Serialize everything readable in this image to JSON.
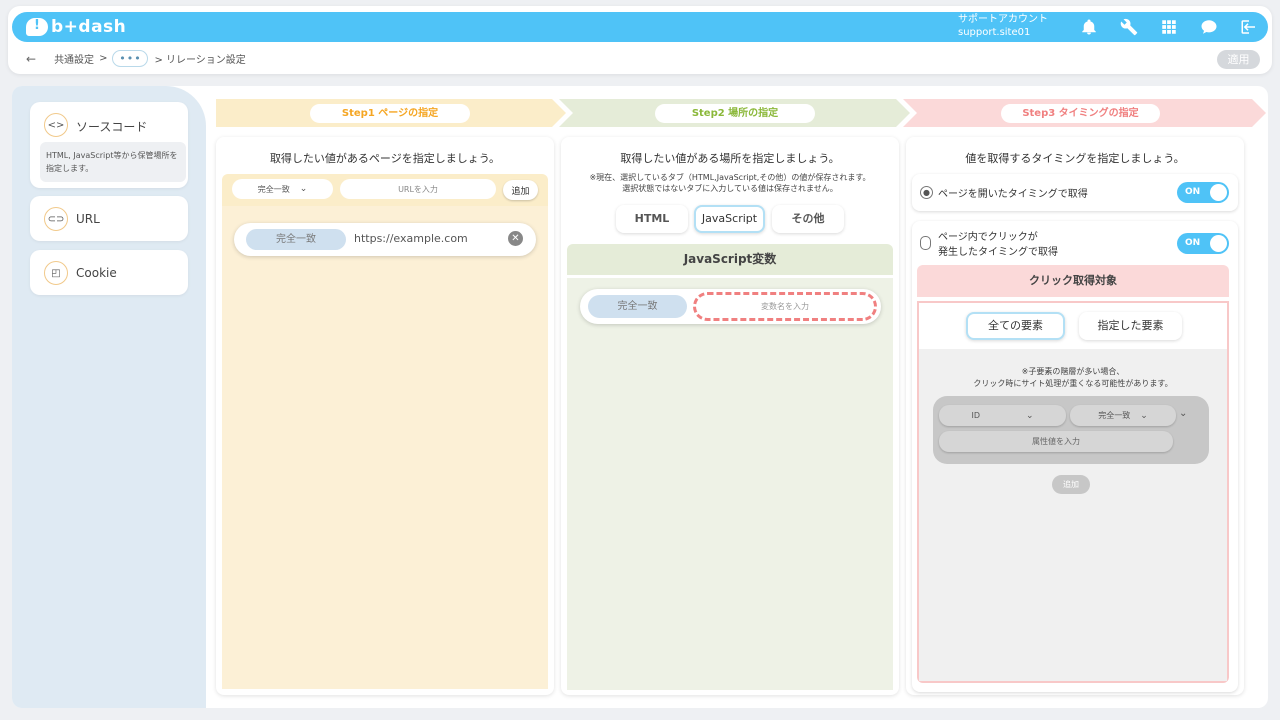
{
  "app": {
    "logo": "b+dash"
  },
  "header": {
    "account_title": "サポートアカウント",
    "account_id": "support.site01",
    "icons": [
      "bell-icon",
      "wrench-icon",
      "grid-icon",
      "chat-icon",
      "logout-icon"
    ]
  },
  "breadcrumb": {
    "back": "←",
    "first": "共通設定",
    "sep": ">",
    "dots": "•••",
    "current": "> リレーション設定"
  },
  "apply_label": "適用",
  "sidebar": {
    "items": [
      {
        "icon": "code-icon",
        "glyph": "<>",
        "label": "ソースコード",
        "desc": "HTML, JavaScript等から保管場所を指定します。"
      },
      {
        "icon": "link-icon",
        "glyph": "⊂⊃",
        "label": "URL"
      },
      {
        "icon": "cookie-icon",
        "glyph": "◰",
        "label": "Cookie"
      }
    ]
  },
  "steps": [
    {
      "label": "Step1 ページの指定",
      "color": "#f5a623",
      "bg": "#fbedc9"
    },
    {
      "label": "Step2 場所の指定",
      "color": "#8bb83a",
      "bg": "#e5ecd8"
    },
    {
      "label": "Step3 タイミングの指定",
      "color": "#f08080",
      "bg": "#fbd9d9"
    }
  ],
  "step1": {
    "title": "取得したい値があるページを指定しましょう。",
    "match_select": "完全一致",
    "url_placeholder": "URLを入力",
    "add_label": "追加",
    "entry_match": "完全一致",
    "entry_url": "https://example.com"
  },
  "step2": {
    "title": "取得したい値がある場所を指定しましょう。",
    "note_1": "※現在、選択しているタブ（HTML,JavaScript,その他）の値が保存されます。",
    "note_2": "選択状態ではないタブに入力している値は保存されません。",
    "tabs": [
      "HTML",
      "JavaScript",
      "その他"
    ],
    "selected_tab": "JavaScript",
    "section_title": "JavaScript変数",
    "match_label": "完全一致",
    "var_placeholder": "変数名を入力"
  },
  "step3": {
    "title": "値を取得するタイミングを指定しましょう。",
    "opt1_label": "ページを開いたタイミングで取得",
    "opt1_toggle": "ON",
    "opt2_label_1": "ページ内でクリックが",
    "opt2_label_2": "発生したタイミングで取得",
    "opt2_toggle": "ON",
    "click_target_title": "クリック取得対象",
    "target_tabs": [
      "全ての要素",
      "指定した要素"
    ],
    "note_1": "※子要素の階層が多い場合、",
    "note_2": "クリック時にサイト処理が重くなる可能性があります。",
    "attr_select": "ID",
    "match_select": "完全一致",
    "attr_placeholder": "属性値を入力",
    "add_label": "追加"
  }
}
